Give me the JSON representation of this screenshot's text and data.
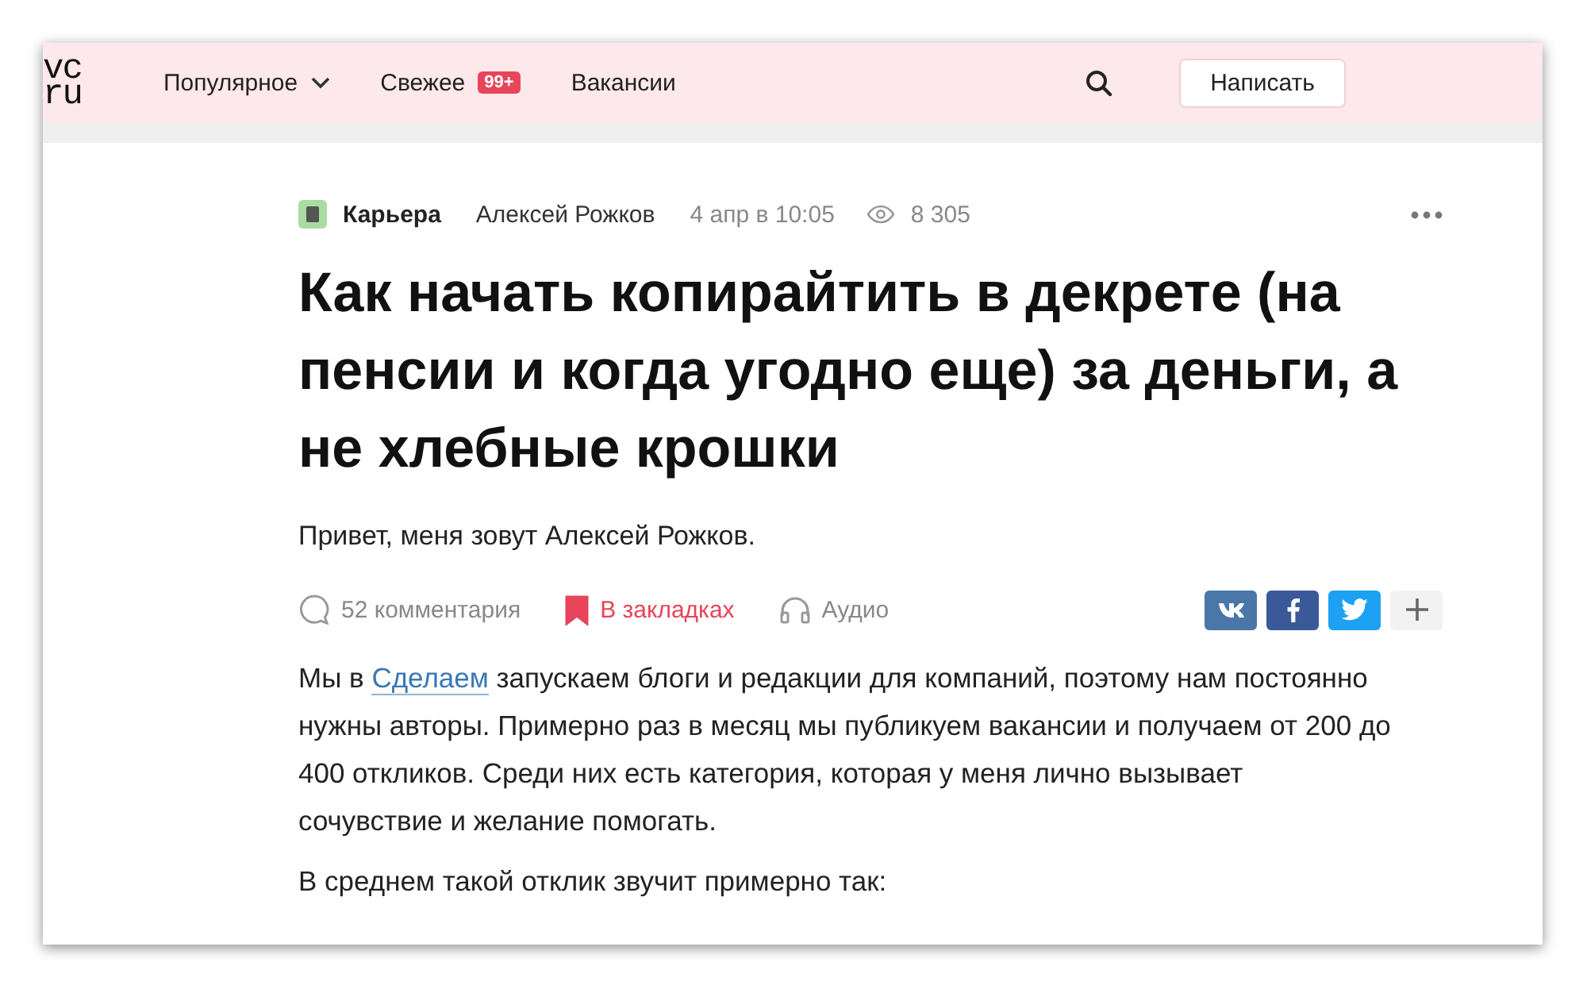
{
  "header": {
    "logo": [
      "vc",
      "ru"
    ],
    "nav": [
      {
        "label": "Популярное",
        "dropdown": true
      },
      {
        "label": "Свежее",
        "dropdown": false,
        "badge": "99+"
      },
      {
        "label": "Вакансии",
        "dropdown": false
      }
    ],
    "write_button": "Написать"
  },
  "article": {
    "meta": {
      "category": "Карьера",
      "author": "Алексей Рожков",
      "date": "4 апр в 10:05",
      "views": "8 305"
    },
    "title": "Как начать копирайтить в декрете (на пенсии и когда угодно еще) за деньги, а не хлебные крошки",
    "lead": "Привет, меня зовут Алексей Рожков.",
    "actions": {
      "comments": "52 комментария",
      "bookmark": {
        "label": "В закладках",
        "bookmarked": true
      },
      "audio": "Аудио"
    },
    "share": [
      {
        "kind": "vk",
        "color": "#4a76a8"
      },
      {
        "kind": "facebook",
        "color": "#3b5998"
      },
      {
        "kind": "twitter",
        "color": "#1da1f2"
      },
      {
        "kind": "more",
        "color": "#f2f2f2"
      }
    ],
    "paragraphs": [
      {
        "before": "Мы в ",
        "link": "Сделаем",
        "after": " запускаем блоги и редакции для компаний, поэтому нам постоянно нужны авторы. Примерно раз в месяц мы публикуем вакансии и получаем от 200 до 400 откликов. Среди них есть категория, которая у меня лично вызывает сочувствие и желание помогать."
      },
      {
        "before": "В среднем такой отклик звучит примерно так:"
      }
    ]
  }
}
